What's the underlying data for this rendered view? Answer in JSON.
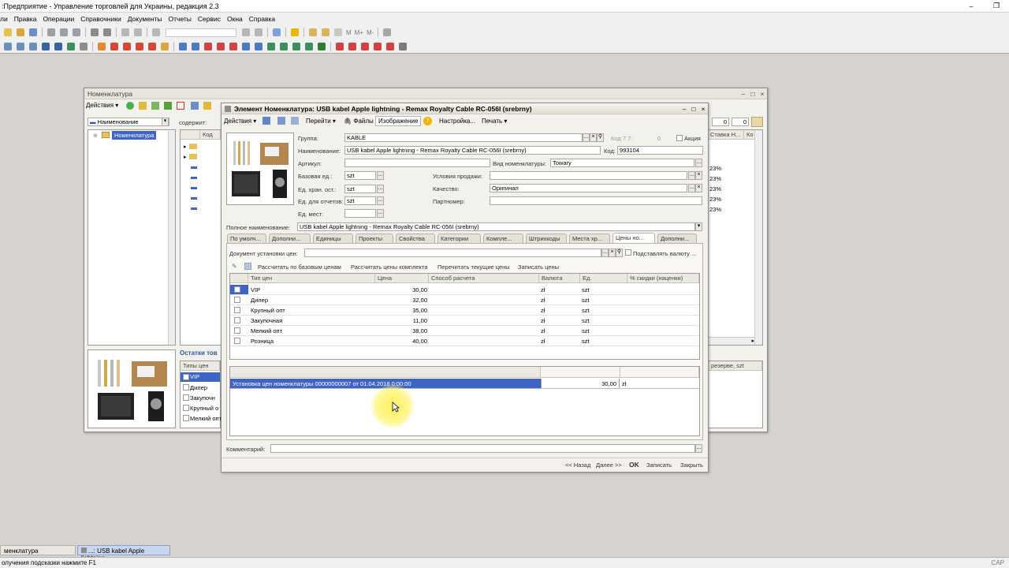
{
  "app_title": ":Предприятие - Управление торговлей для Украины, редакция 2.3",
  "menu": [
    "ли",
    "Правка",
    "Операции",
    "Справочники",
    "Документы",
    "Отчеты",
    "Сервис",
    "Окна",
    "Справка"
  ],
  "toolbar": {
    "m1": "M",
    "m2": "M+",
    "m3": "M-"
  },
  "nomenclature_window": {
    "title": "Номенклатура",
    "actions_label": "Действия ▾",
    "filter_value": "Наименование",
    "contains_label": "содержит:",
    "tree_root": "Номенклатура",
    "col_kod": "Код",
    "col_stavka": "Ставка Н...",
    "col_ko": "Ко",
    "vat_values": [
      "23%",
      "23%",
      "23%",
      "23%",
      "23%"
    ],
    "num_a": "0",
    "num_b": "0",
    "stock_label": "Остатки тов",
    "price_types_header": "Типы цен",
    "price_types": [
      "VIP",
      "Дилер",
      "Закупочн",
      "Крупный о",
      "Мелкий опт"
    ],
    "reserve_header": "резерве, szt"
  },
  "element_window": {
    "title": "Элемент Номенклатура: USB kabel Apple lightning - Remax Royalty Cable RC-056I (srebrny)",
    "toolbar": {
      "actions": "Действия ▾",
      "go": "Перейти ▾",
      "files": "Файлы",
      "image": "Изображение",
      "settings": "Настройка...",
      "print": "Печать ▾"
    },
    "labels": {
      "group": "Группа:",
      "name": "Наименование:",
      "article": "Артикул:",
      "base_unit": "Базовая ед.:",
      "storage_unit": "Ед. хран. ост.:",
      "report_unit": "Ед. для отчетов:",
      "place_unit": "Ед. мест:",
      "kod77": "Код 7.7:",
      "kod": "Код:",
      "akciya": "Акция",
      "nom_type": "Вид номенклатуры:",
      "sale_terms": "Условия продажи:",
      "quality": "Качество:",
      "partnumber": "Партномер:",
      "full_name": "Полное наименование:"
    },
    "values": {
      "group": "KABLE",
      "name": "USB kabel Apple lightning - Remax Royalty Cable RC-056I (srebrny)",
      "article": "",
      "base_unit": "szt",
      "storage_unit": "szt",
      "report_unit": "szt",
      "place_unit": "",
      "kod77": "0",
      "kod": "993104",
      "nom_type": "Towary",
      "sale_terms": "",
      "quality": "Оригинал",
      "partnumber": "",
      "full_name": "USB kabel Apple lightning - Remax Royalty Cable RC-056I (srebrny)"
    },
    "tabs": [
      "По умолч...",
      "Дополни...",
      "Единицы",
      "Проекты",
      "Свойства",
      "Категории",
      "Компле...",
      "Штрихкоды",
      "Места хр...",
      "Цены но...",
      "Дополни..."
    ],
    "prices": {
      "doc_label": "Документ установки цен:",
      "doc_value": "",
      "substitute_currency": "Подставлять валюту ...",
      "btn_base": "Рассчитать по базовым ценам",
      "btn_kit": "Рассчитать цены комплекта",
      "btn_reread": "Перечитать текущие цены",
      "btn_write": "Записать цены",
      "columns": [
        "Тип цен",
        "Цена",
        "Способ расчета",
        "Валюта",
        "Ед.",
        "% скидки (наценки)"
      ],
      "rows": [
        {
          "type": "VIP",
          "price": "30,00",
          "calc": "",
          "currency": "zł",
          "unit": "szt",
          "discount": ""
        },
        {
          "type": "Дилер",
          "price": "32,00",
          "calc": "",
          "currency": "zł",
          "unit": "szt",
          "discount": ""
        },
        {
          "type": "Крупный опт",
          "price": "35,00",
          "calc": "",
          "currency": "zł",
          "unit": "szt",
          "discount": ""
        },
        {
          "type": "Закупочная",
          "price": "11,00",
          "calc": "",
          "currency": "zł",
          "unit": "szt",
          "discount": ""
        },
        {
          "type": "Мелкий опт",
          "price": "38,00",
          "calc": "",
          "currency": "zł",
          "unit": "szt",
          "discount": ""
        },
        {
          "type": "Розница",
          "price": "40,00",
          "calc": "",
          "currency": "zł",
          "unit": "szt",
          "discount": ""
        }
      ],
      "history_row": {
        "doc": "Установка цен номенклатуры 00000000007 от 01.04.2018 0:00:00",
        "price": "30,00",
        "currency": "zł"
      }
    },
    "comment_label": "Комментарий:",
    "comment_value": "",
    "footer": {
      "back": "<< Назад",
      "next": "Далее >>",
      "ok": "OK",
      "save": "Записать",
      "close": "Закрыть"
    }
  },
  "taskbar": [
    "менклатура",
    "...: USB kabel Apple lightning"
  ],
  "status": {
    "hint": "олучения подсказки нажмите F1",
    "caps": "CAP"
  },
  "colors": {
    "selection": "#3e64c5",
    "panel": "#f3f1ec",
    "highlight": "#ffe94d"
  }
}
